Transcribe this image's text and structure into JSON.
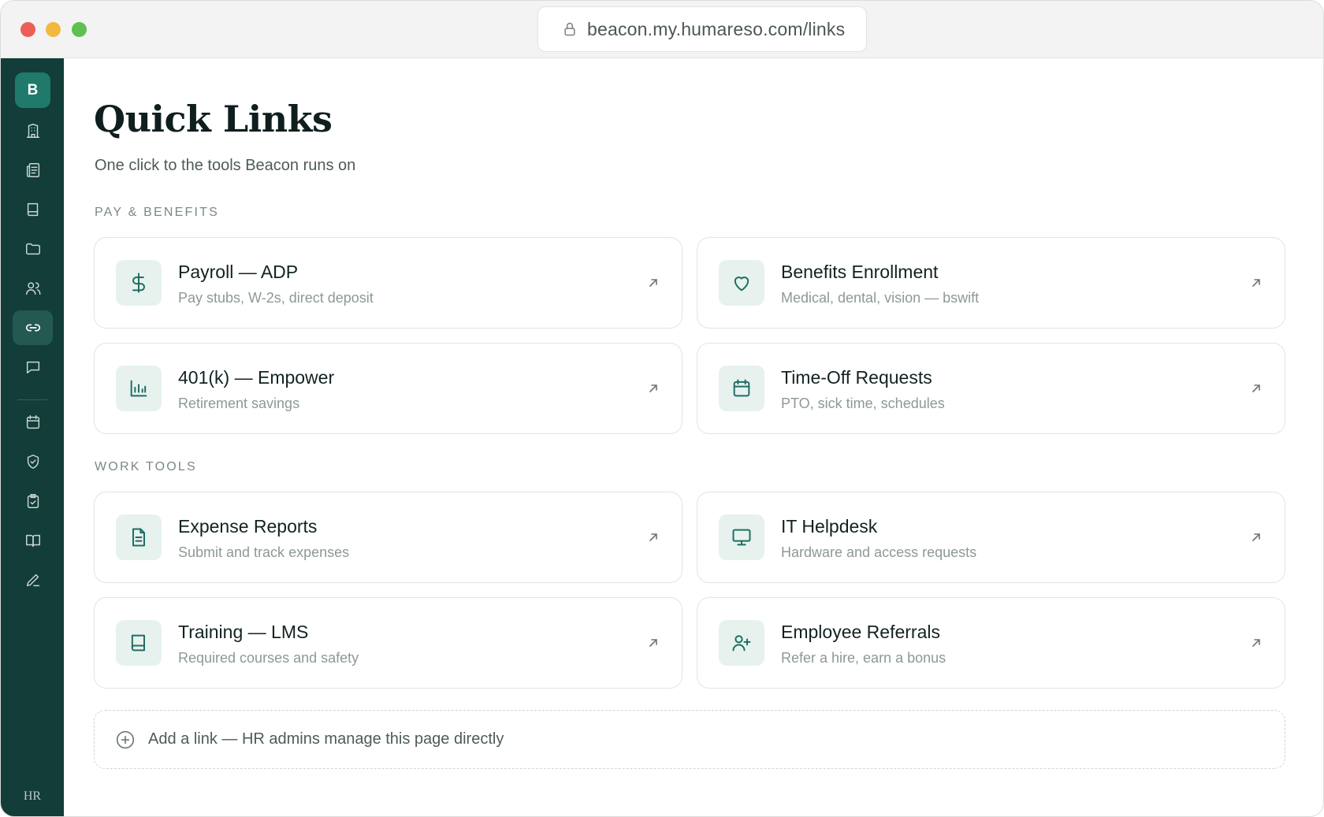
{
  "browser": {
    "url": "beacon.my.humareso.com/links"
  },
  "sidebar": {
    "brand_letter": "B",
    "footer": "HR",
    "items": [
      {
        "icon": "building-icon"
      },
      {
        "icon": "newspaper-icon"
      },
      {
        "icon": "book-icon"
      },
      {
        "icon": "folder-icon"
      },
      {
        "icon": "users-icon"
      },
      {
        "icon": "link-icon",
        "active": true
      },
      {
        "icon": "chat-icon"
      },
      {
        "icon": "calendar-icon"
      },
      {
        "icon": "shield-check-icon"
      },
      {
        "icon": "clipboard-check-icon"
      },
      {
        "icon": "open-book-icon"
      },
      {
        "icon": "pen-icon"
      }
    ]
  },
  "page": {
    "title": "Quick Links",
    "subtitle": "One click to the tools Beacon runs on"
  },
  "sections": [
    {
      "label": "PAY & BENEFITS",
      "cards": [
        {
          "title": "Payroll — ADP",
          "subtitle": "Pay stubs, W-2s, direct deposit",
          "icon": "dollar-icon"
        },
        {
          "title": "Benefits Enrollment",
          "subtitle": "Medical, dental, vision — bswift",
          "icon": "heart-icon"
        },
        {
          "title": "401(k) — Empower",
          "subtitle": "Retirement savings",
          "icon": "bar-chart-icon"
        },
        {
          "title": "Time-Off Requests",
          "subtitle": "PTO, sick time, schedules",
          "icon": "calendar-icon"
        }
      ]
    },
    {
      "label": "WORK TOOLS",
      "cards": [
        {
          "title": "Expense Reports",
          "subtitle": "Submit and track expenses",
          "icon": "document-icon"
        },
        {
          "title": "IT Helpdesk",
          "subtitle": "Hardware and access requests",
          "icon": "monitor-icon"
        },
        {
          "title": "Training — LMS",
          "subtitle": "Required courses and safety",
          "icon": "book-icon"
        },
        {
          "title": "Employee Referrals",
          "subtitle": "Refer a hire, earn a bonus",
          "icon": "user-plus-icon"
        }
      ]
    }
  ],
  "add_link": {
    "label": "Add a link — HR admins manage this page directly"
  },
  "colors": {
    "sidebar_bg": "#123d38",
    "brand_bg": "#1f7a6b",
    "icon_tint": "#1f6e62",
    "icon_box_bg": "#e7f2ef"
  }
}
